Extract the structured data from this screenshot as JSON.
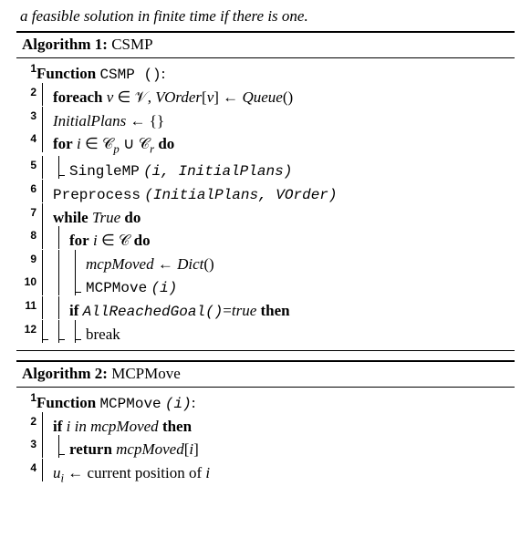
{
  "intro_fragment": "a feasible solution in finite time if there is one.",
  "algo1": {
    "label": "Algorithm 1:",
    "name": "CSMP",
    "lines": [
      {
        "n": "1",
        "depth": 0,
        "bars": "",
        "html": "<span class='kw'>Function</span> <span class='fn'>CSMP ()</span>:"
      },
      {
        "n": "2",
        "depth": 1,
        "bars": "b",
        "html": "<span class='kw'>foreach</span> <span class='it'>v</span> ∈ 𝒱, <span class='it'>VOrder</span>[<span class='it'>v</span>] ← <span class='it'>Queue</span>()"
      },
      {
        "n": "3",
        "depth": 1,
        "bars": "b",
        "html": "<span class='it'>InitialPlans</span> ← {}"
      },
      {
        "n": "4",
        "depth": 1,
        "bars": "b",
        "html": "<span class='kw'>for</span> <span class='it'>i</span> ∈ 𝒞<span class='sub'>p</span> ∪ 𝒞<span class='sub'>r</span> <span class='kw'>do</span>"
      },
      {
        "n": "5",
        "depth": 2,
        "bars": "be",
        "html": "<span class='fn'>SingleMP</span> <span class='itfn'>(i, InitialPlans)</span>"
      },
      {
        "n": "6",
        "depth": 1,
        "bars": "b",
        "html": "<span class='fn'>Preprocess</span> <span class='itfn'>(InitialPlans, VOrder)</span>"
      },
      {
        "n": "7",
        "depth": 1,
        "bars": "b",
        "html": "<span class='kw'>while</span> <span class='it'>True</span> <span class='kw'>do</span>"
      },
      {
        "n": "8",
        "depth": 2,
        "bars": "bb",
        "html": "<span class='kw'>for</span> <span class='it'>i</span> ∈ 𝒞 <span class='kw'>do</span>"
      },
      {
        "n": "9",
        "depth": 3,
        "bars": "bbb",
        "html": "<span class='it'>mcpMoved</span> ← <span class='it'>Dict</span>()"
      },
      {
        "n": "10",
        "depth": 3,
        "bars": "bbe",
        "html": "<span class='fn'>MCPMove</span> <span class='itfn'>(i)</span>"
      },
      {
        "n": "11",
        "depth": 2,
        "bars": "bb",
        "html": "<span class='kw'>if</span> <span class='itfn'>AllReachedGoal()</span>=<span class='it'>true</span> <span class='kw'>then</span>"
      },
      {
        "n": "12",
        "depth": 3,
        "bars": "eee",
        "html": "break"
      }
    ]
  },
  "algo2": {
    "label": "Algorithm 2:",
    "name": "MCPMove",
    "lines": [
      {
        "n": "1",
        "depth": 0,
        "bars": "",
        "html": "<span class='kw'>Function</span> <span class='fn'>MCPMove</span> <span class='itfn'>(i)</span>:"
      },
      {
        "n": "2",
        "depth": 1,
        "bars": "b",
        "html": "<span class='kw'>if</span> <span class='it'>i</span> <span class='it'>in</span> <span class='it'>mcpMoved</span> <span class='kw'>then</span>"
      },
      {
        "n": "3",
        "depth": 2,
        "bars": "be",
        "html": "<span class='kw'>return</span> <span class='it'>mcpMoved</span>[<span class='it'>i</span>]"
      },
      {
        "n": "4",
        "depth": 1,
        "bars": "b",
        "html": "<span class='it'>u<span class='sub'>i</span></span> ← current position of <span class='it'>i</span>"
      }
    ]
  }
}
